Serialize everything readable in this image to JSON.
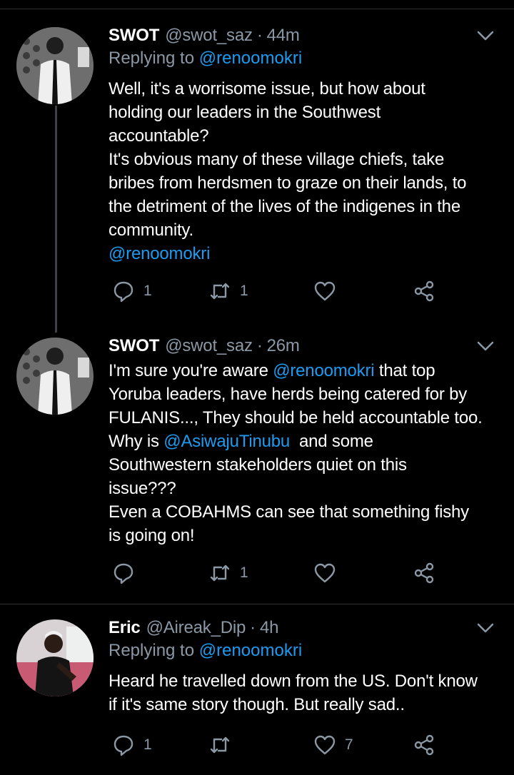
{
  "tweets": [
    {
      "name": "SWOT",
      "handle": "@swot_saz",
      "dot": "·",
      "time": "44m",
      "replying_prefix": "Replying to ",
      "replying_to": "@renoomokri",
      "lines": [
        "Well, it's a worrisome issue, but how about",
        "holding our leaders in the Southwest",
        "accountable?",
        "It's obvious many of these village chiefs, take",
        "bribes from herdsmen to graze on their lands, to",
        "the detriment of the lives of the indigenes in the",
        "community."
      ],
      "trailing_mention": "@renoomokri",
      "reply_count": "1",
      "retweet_count": "1",
      "like_count": ""
    },
    {
      "name": "SWOT",
      "handle": "@swot_saz",
      "dot": "·",
      "time": "26m",
      "line1_pre": "I'm sure you're aware ",
      "line1_mention": "@renoomokri",
      "line1_post": " that top",
      "line2": "Yoruba leaders, have herds being catered for by",
      "line3": "FULANIS..., They should be held accountable too.",
      "line4_pre": "Why is ",
      "line4_mention": "@AsiwajuTinubu",
      "line4_post": "  and some",
      "line5": "Southwestern stakeholders quiet on this",
      "line6": "issue???",
      "line7": "Even a COBAHMS can see that something fishy",
      "line8": "is going on!",
      "reply_count": "",
      "retweet_count": "1",
      "like_count": ""
    },
    {
      "name": "Eric",
      "handle": "@Aireak_Dip",
      "dot": "·",
      "time": "4h",
      "replying_prefix": "Replying to ",
      "replying_to": "@renoomokri",
      "lines": [
        "Heard he travelled down from the US. Don't know",
        "if it's same story though. But really sad.."
      ],
      "reply_count": "1",
      "retweet_count": "",
      "like_count": "7"
    }
  ],
  "colors": {
    "background": "#000000",
    "secondary_text": "#8b98a5",
    "mention": "#1d9bf0",
    "divider": "#2f3336",
    "thread_line": "#3d4044"
  },
  "icons": [
    "chevron-down-icon",
    "reply-icon",
    "retweet-icon",
    "like-icon",
    "share-icon"
  ]
}
